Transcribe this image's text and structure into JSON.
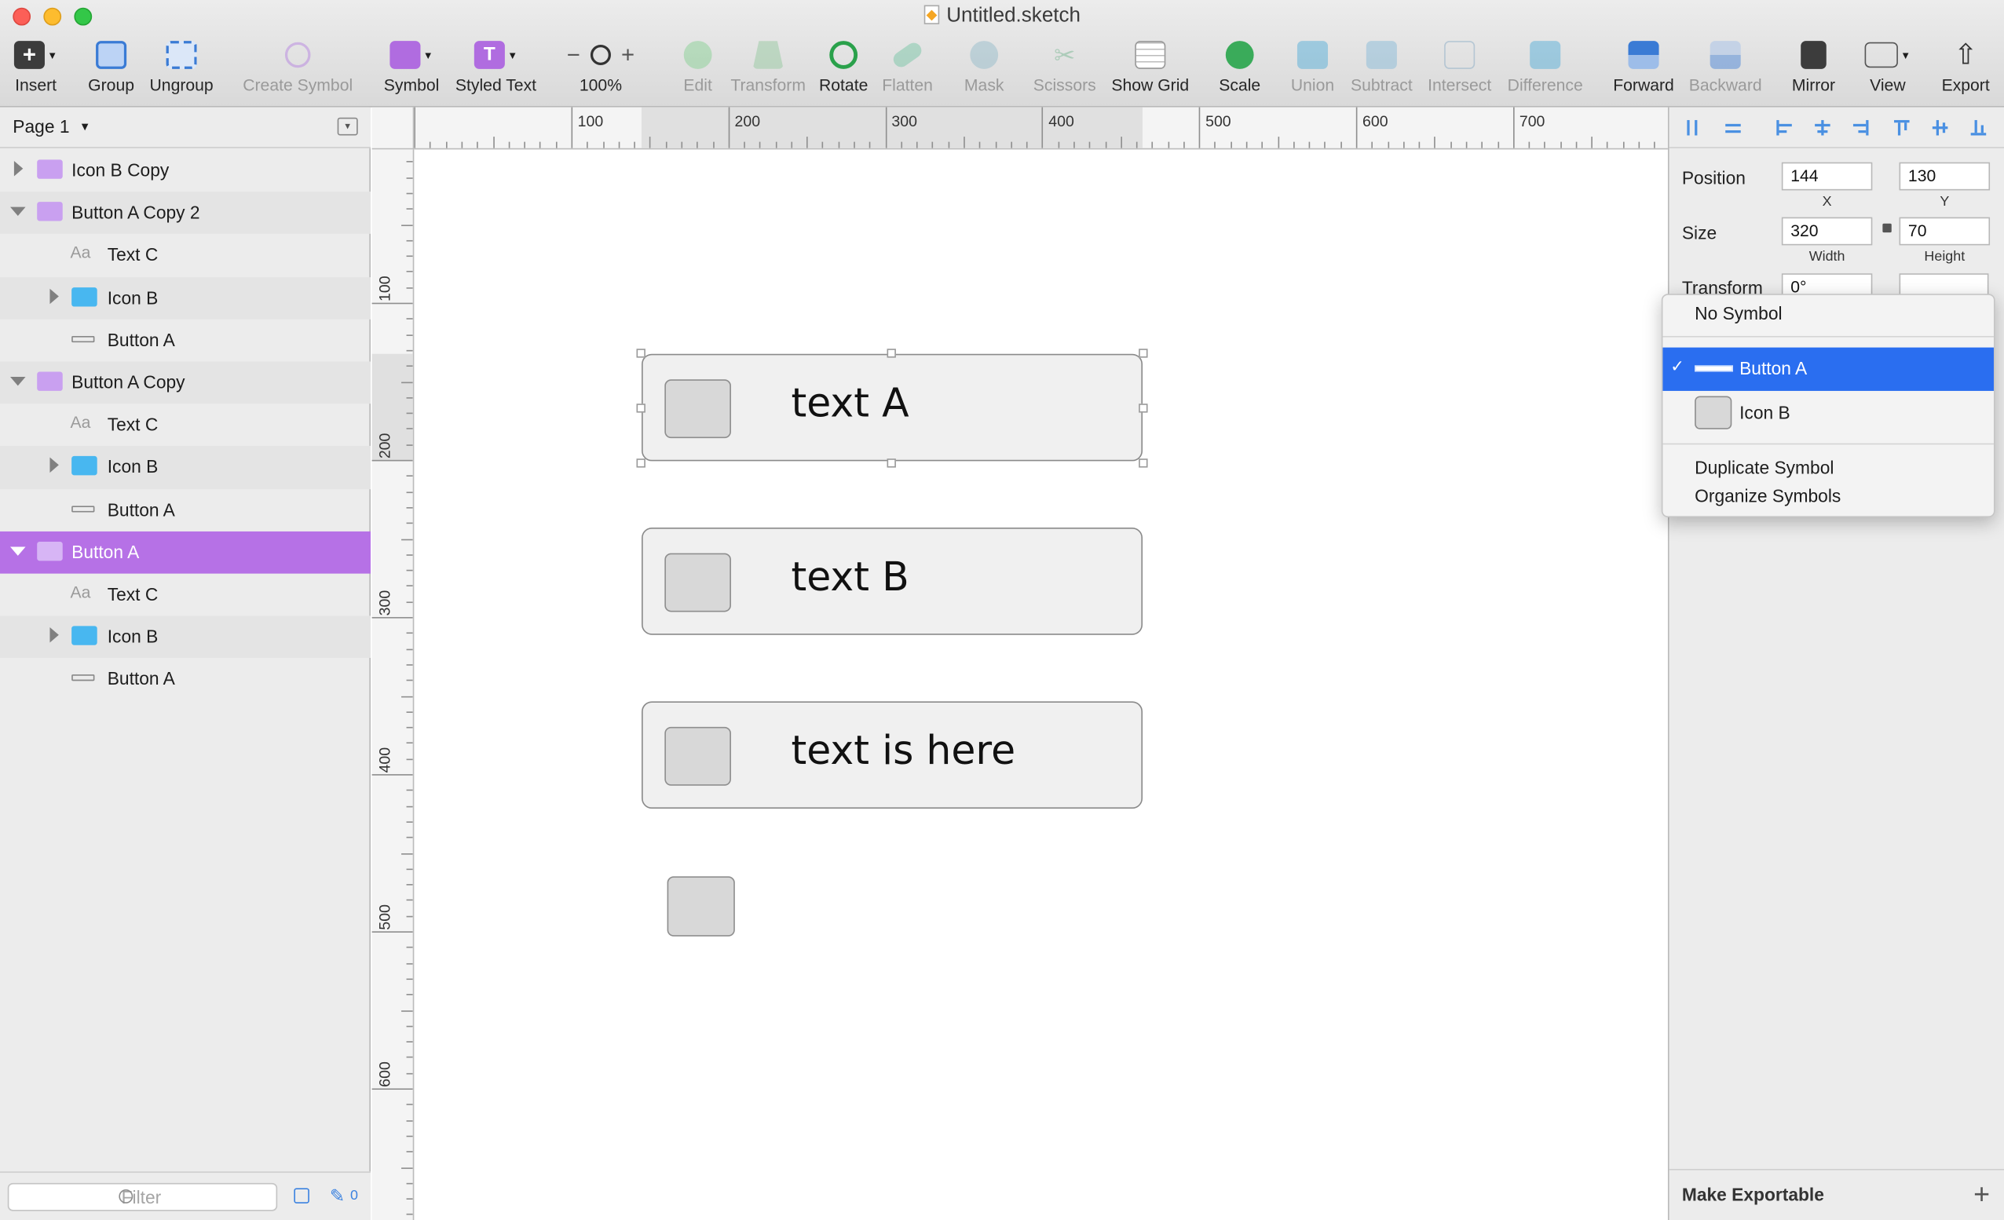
{
  "window": {
    "title": "Untitled.sketch"
  },
  "toolbar": {
    "insert": "Insert",
    "group": "Group",
    "ungroup": "Ungroup",
    "create_symbol": "Create Symbol",
    "symbol": "Symbol",
    "styled_text": "Styled Text",
    "zoom": "100%",
    "edit": "Edit",
    "transform": "Transform",
    "rotate": "Rotate",
    "flatten": "Flatten",
    "mask": "Mask",
    "scissors": "Scissors",
    "show_grid": "Show Grid",
    "scale": "Scale",
    "union": "Union",
    "subtract": "Subtract",
    "intersect": "Intersect",
    "difference": "Difference",
    "forward": "Forward",
    "backward": "Backward",
    "mirror": "Mirror",
    "view": "View",
    "export": "Export"
  },
  "layers_panel": {
    "page": "Page 1",
    "items": [
      {
        "label": "Icon B Copy",
        "kind": "symbol-folder",
        "disclosure": "collapsed",
        "indent": 0
      },
      {
        "label": "Button A Copy 2",
        "kind": "symbol-folder",
        "disclosure": "expanded",
        "indent": 0
      },
      {
        "label": "Text C",
        "kind": "text",
        "indent": 1
      },
      {
        "label": "Icon B",
        "kind": "folder",
        "disclosure": "collapsed",
        "indent": 1
      },
      {
        "label": "Button A",
        "kind": "rectangle",
        "indent": 1
      },
      {
        "label": "Button A Copy",
        "kind": "symbol-folder",
        "disclosure": "expanded",
        "indent": 0
      },
      {
        "label": "Text C",
        "kind": "text",
        "indent": 1
      },
      {
        "label": "Icon B",
        "kind": "folder",
        "disclosure": "collapsed",
        "indent": 1
      },
      {
        "label": "Button A",
        "kind": "rectangle",
        "indent": 1
      },
      {
        "label": "Button A",
        "kind": "symbol-folder",
        "disclosure": "expanded",
        "indent": 0,
        "selected": true
      },
      {
        "label": "Text C",
        "kind": "text",
        "indent": 1
      },
      {
        "label": "Icon B",
        "kind": "folder",
        "disclosure": "collapsed",
        "indent": 1
      },
      {
        "label": "Button A",
        "kind": "rectangle",
        "indent": 1
      }
    ],
    "filter_placeholder": "Filter",
    "slice_count": "0"
  },
  "rulers": {
    "top": [
      "100",
      "200",
      "300",
      "400",
      "500",
      "600",
      "700"
    ],
    "left": [
      "100",
      "200",
      "300",
      "400",
      "500",
      "600"
    ]
  },
  "canvas": {
    "buttons": [
      "text A",
      "text B",
      "text is here"
    ]
  },
  "inspector": {
    "position_label": "Position",
    "x": "144",
    "y": "130",
    "x_label": "X",
    "y_label": "Y",
    "size_label": "Size",
    "width": "320",
    "height": "70",
    "width_label": "Width",
    "height_label": "Height",
    "transform_label": "Transform",
    "rotation": "0°",
    "make_exportable": "Make Exportable"
  },
  "symbol_menu": {
    "no_symbol": "No Symbol",
    "symbols": [
      {
        "label": "Button A",
        "checked": true
      },
      {
        "label": "Icon B",
        "checked": false
      }
    ],
    "duplicate": "Duplicate Symbol",
    "organize": "Organize Symbols"
  },
  "colors": {
    "selection": "#b671e6",
    "menu_highlight": "#2a6ef0",
    "symbol_purple": "#c9a0f0",
    "group_blue": "#48b7f0"
  }
}
